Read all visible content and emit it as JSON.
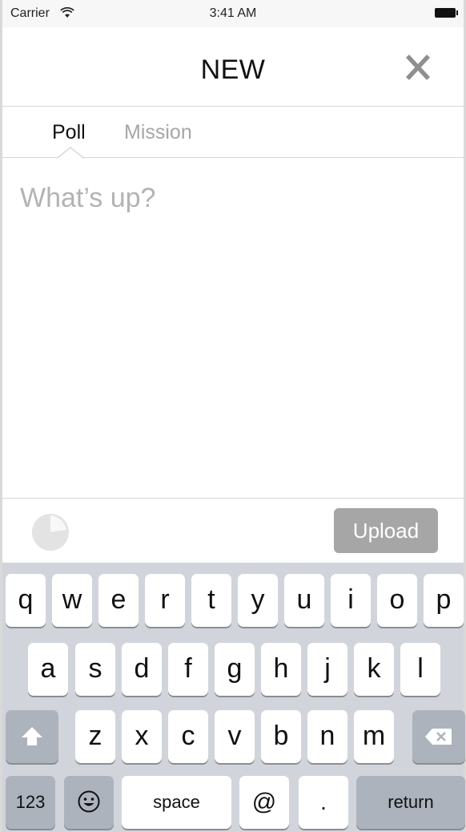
{
  "status_bar": {
    "carrier": "Carrier",
    "time": "3:41 AM"
  },
  "nav": {
    "title": "NEW",
    "close_icon": "close-icon"
  },
  "tabs": [
    {
      "label": "Poll",
      "selected": true
    },
    {
      "label": "Mission",
      "selected": false
    }
  ],
  "compose": {
    "placeholder": "What’s up?"
  },
  "toolbar": {
    "timer_icon": "pie-timer-icon",
    "upload_label": "Upload"
  },
  "keyboard": {
    "row1": [
      "q",
      "w",
      "e",
      "r",
      "t",
      "y",
      "u",
      "i",
      "o",
      "p"
    ],
    "row2": [
      "a",
      "s",
      "d",
      "f",
      "g",
      "h",
      "j",
      "k",
      "l"
    ],
    "row3": [
      "z",
      "x",
      "c",
      "v",
      "b",
      "n",
      "m"
    ],
    "shift_icon": "shift-icon",
    "delete_icon": "backspace-icon",
    "numbers_label": "123",
    "emoji_icon": "emoji-icon",
    "space_label": "space",
    "at_label": "@",
    "period_label": ".",
    "return_label": "return"
  },
  "colors": {
    "upload_bg": "#a6a6a6",
    "keyboard_bg": "#d1d5db",
    "dark_key": "#acb3bd",
    "placeholder": "#b3b3b3"
  }
}
